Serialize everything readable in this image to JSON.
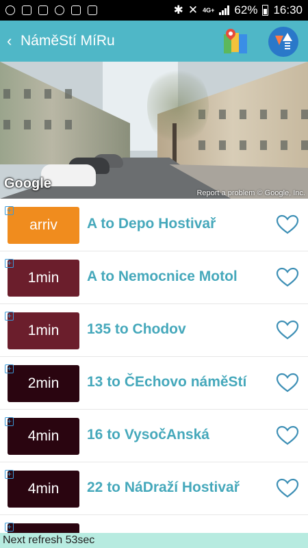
{
  "status_bar": {
    "network_label": "4G+",
    "battery_text": "62%",
    "time": "16:30",
    "left_icons": [
      "chat-bubble-icon",
      "image-icon",
      "inbox-icon",
      "vpn-icon",
      "mail-icon",
      "flash-icon"
    ],
    "right_icons": [
      "bluetooth-icon",
      "mute-icon",
      "signal-icon",
      "battery-icon"
    ]
  },
  "header": {
    "back_glyph": "‹",
    "title": "NáměStí MíRu",
    "background": "#4fb7c7"
  },
  "street_view": {
    "logo_text": "Google",
    "credit_text": "Report a problem  © Google, Inc."
  },
  "departures": [
    {
      "time": "arriv",
      "route": "A to Depo Hostivař",
      "badge_color": "#f08c1e"
    },
    {
      "time": "1min",
      "route": "A to Nemocnice Motol",
      "badge_color": "#6b1e2c"
    },
    {
      "time": "1min",
      "route": "135 to Chodov",
      "badge_color": "#6b1e2c"
    },
    {
      "time": "2min",
      "route": "13 to ČEchovo náměStí",
      "badge_color": "#2a0510"
    },
    {
      "time": "4min",
      "route": "16 to VysočAnská",
      "badge_color": "#2a0510"
    },
    {
      "time": "4min",
      "route": "22 to NáDraží Hostivař",
      "badge_color": "#2a0510"
    },
    {
      "time": "",
      "route": "",
      "badge_color": "#2a0510"
    }
  ],
  "footer": {
    "refresh_text": "Next refresh 53sec"
  },
  "colors": {
    "accent": "#4fb7c7",
    "route_text": "#45a8bb",
    "heart": "#3d8fb5",
    "footer_bg": "#b7ebe0"
  }
}
